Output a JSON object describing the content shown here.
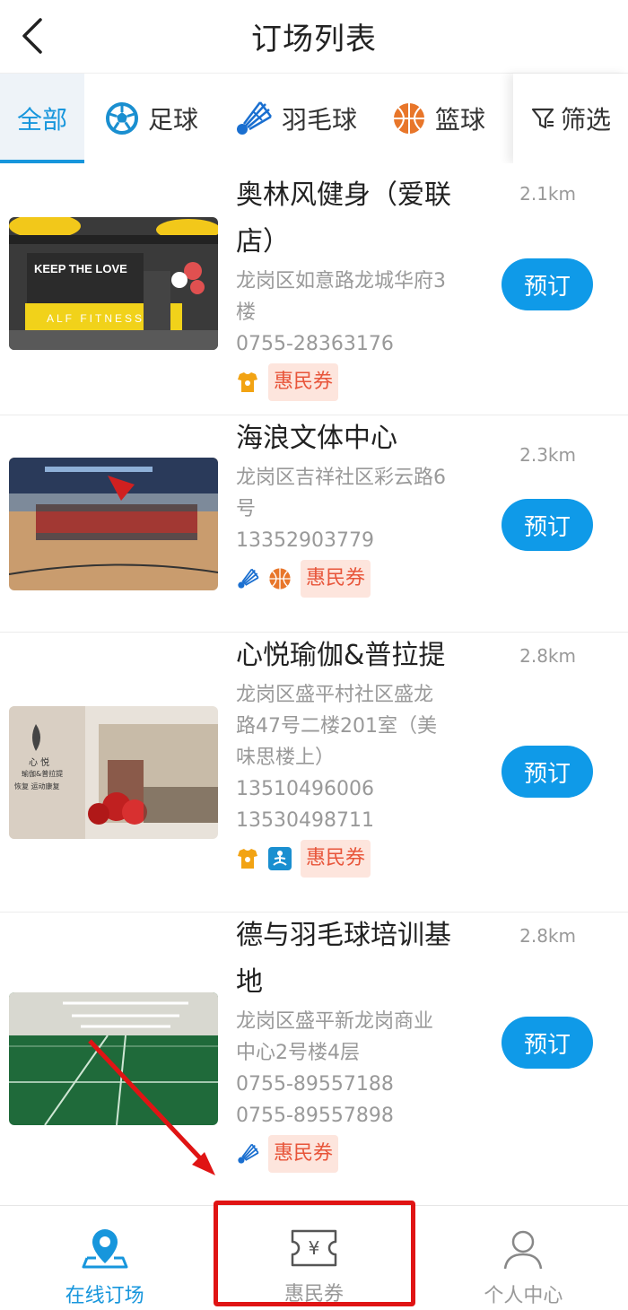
{
  "header": {
    "title": "订场列表",
    "back_icon": "chevron-left-icon"
  },
  "tabs": [
    {
      "label": "全部",
      "icon": "",
      "active": true
    },
    {
      "label": "足球",
      "icon": "soccer-ball-icon",
      "active": false
    },
    {
      "label": "羽毛球",
      "icon": "shuttlecock-icon",
      "active": false
    },
    {
      "label": "篮球",
      "icon": "basketball-icon",
      "active": false
    }
  ],
  "filter": {
    "label": "筛选",
    "icon": "filter-icon"
  },
  "venues": [
    {
      "name_line1": "奥林风健身（爱联",
      "name_line2": "店）",
      "address_line1": "龙岗区如意路龙城华府3",
      "address_line2": "楼",
      "phones": [
        "0755-28363176"
      ],
      "distance": "2.1km",
      "tags": [
        "fitness-icon"
      ],
      "voucher": "惠民券",
      "book_label": "预订",
      "photo_texts": [
        "KEEP THE LOVE",
        "ALF FITNESS"
      ]
    },
    {
      "name_line1": "海浪文体中心",
      "address_line1": "龙岗区吉祥社区彩云路6",
      "address_line2": "号",
      "phones": [
        "13352903779"
      ],
      "distance": "2.3km",
      "tags": [
        "shuttlecock-icon",
        "basketball-icon"
      ],
      "voucher": "惠民券",
      "book_label": "预订"
    },
    {
      "name_line1": "心悦瑜伽&普拉提",
      "address_line1": "龙岗区盛平村社区盛龙",
      "address_line2": "路47号二楼201室（美",
      "address_line3": "味思楼上）",
      "phones": [
        "13510496006",
        "13530498711"
      ],
      "distance": "2.8km",
      "tags": [
        "fitness-icon",
        "yoga-icon"
      ],
      "voucher": "惠民券",
      "book_label": "预订",
      "photo_texts": [
        "心 悦",
        "瑜伽&普拉提",
        "恢复 运动康复"
      ]
    },
    {
      "name_line1": "德与羽毛球培训基",
      "name_line2": "地",
      "address_line1": "龙岗区盛平新龙岗商业",
      "address_line2": "中心2号楼4层",
      "phones": [
        "0755-89557188",
        "0755-89557898"
      ],
      "distance": "2.8km",
      "tags": [
        "shuttlecock-icon"
      ],
      "voucher": "惠民券",
      "book_label": "预订"
    }
  ],
  "bottom_nav": [
    {
      "label": "在线订场",
      "icon": "map-pin-icon",
      "active": true
    },
    {
      "label": "惠民券",
      "icon": "yen-ticket-icon",
      "active": false
    },
    {
      "label": "个人中心",
      "icon": "user-icon",
      "active": false
    }
  ],
  "colors": {
    "accent": "#1796dc",
    "book_button": "#0f9ae8",
    "voucher_text": "#e8553a",
    "voucher_bg": "#fde5dd",
    "annotation_red": "#e01414"
  }
}
